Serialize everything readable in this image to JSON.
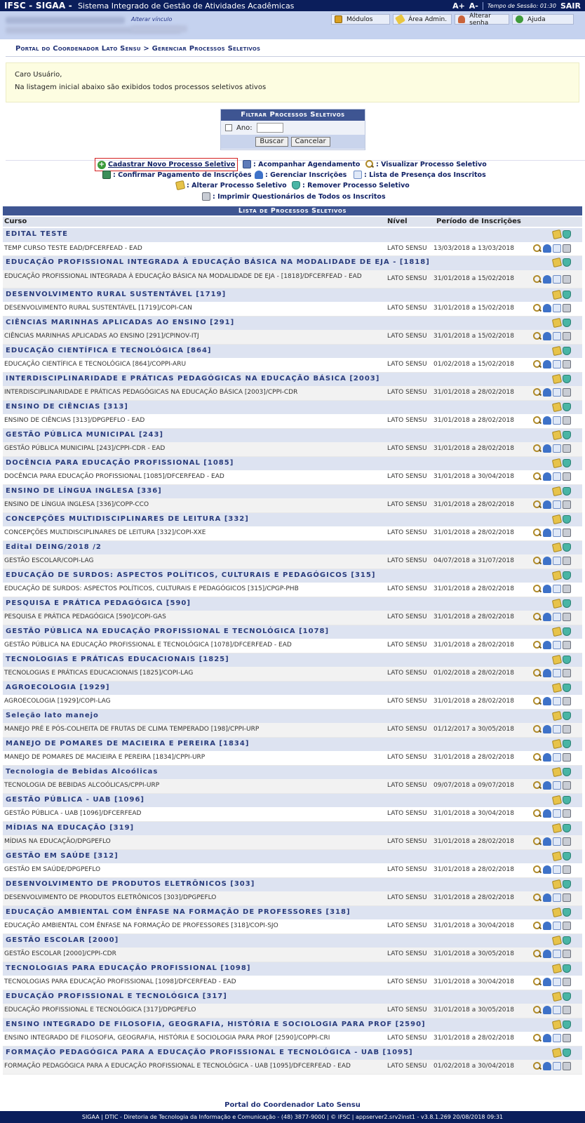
{
  "topbar": {
    "brand": "IFSC - SIGAA -",
    "subtitle": "Sistema Integrado de Gestão de Atividades Acadêmicas",
    "font_inc": "A+",
    "font_dec": "A-",
    "session_label": "Tempo de Sessão: 01:30",
    "logout": "SAIR"
  },
  "userbar": {
    "alter_link": "Alterar vínculo",
    "menu": {
      "modulos": "Módulos",
      "area_admin": "Área Admin.",
      "alterar_senha": "Alterar senha",
      "ajuda": "Ajuda"
    }
  },
  "breadcrumb": "Portal do Coordenador Lato Sensu > Gerenciar Processos Seletivos",
  "info": {
    "greeting": "Caro Usuário,",
    "message": "Na listagem inicial abaixo são exibidos todos processos seletivos ativos"
  },
  "filter": {
    "title": "Filtrar Processos Seletivos",
    "ano_label": "Ano:",
    "buscar": "Buscar",
    "cancelar": "Cancelar"
  },
  "legend": {
    "cadastrar": "Cadastrar Novo Processo Seletivo",
    "acompanhar": ": Acompanhar Agendamento",
    "visualizar": ": Visualizar Processo Seletivo",
    "confirmar": ": Confirmar Pagamento de Inscrições",
    "gerenciar": ": Gerenciar Inscrições",
    "lista_presenca": ": Lista de Presença dos Inscritos",
    "alterar": ": Alterar Processo Seletivo",
    "remover": ": Remover Processo Seletivo",
    "imprimir": ": Imprimir Questionários de Todos os Inscritos"
  },
  "table": {
    "caption": "Lista de Processos Seletivos",
    "col_curso": "Curso",
    "col_nivel": "Nível",
    "col_periodo": "Período de Inscrições",
    "groups": [
      {
        "title": "EDITAL TESTE",
        "curso": "TEMP CURSO TESTE EAD/DFCERFEAD - EAD",
        "nivel": "LATO SENSU",
        "periodo": "13/03/2018 a 13/03/2018"
      },
      {
        "title": "EDUCAÇÃO PROFISSIONAL INTEGRADA À EDUCAÇÃO BÁSICA NA MODALIDADE DE EJA - [1818]",
        "curso": "EDUCAÇÃO PROFISSIONAL INTEGRADA À EDUCAÇÃO BÁSICA NA MODALIDADE DE EJA - [1818]/DFCERFEAD - EAD",
        "nivel": "LATO SENSU",
        "periodo": "31/01/2018 a 15/02/2018"
      },
      {
        "title": "DESENVOLVIMENTO RURAL SUSTENTÁVEL [1719]",
        "curso": "DESENVOLVIMENTO RURAL SUSTENTÁVEL [1719]/COPI-CAN",
        "nivel": "LATO SENSU",
        "periodo": "31/01/2018 a 15/02/2018"
      },
      {
        "title": "CIÊNCIAS MARINHAS APLICADAS AO ENSINO [291]",
        "curso": "CIÊNCIAS MARINHAS APLICADAS AO ENSINO [291]/CPINOV-ITJ",
        "nivel": "LATO SENSU",
        "periodo": "31/01/2018 a 15/02/2018"
      },
      {
        "title": "EDUCAÇÃO CIENTÍFICA E TECNOLÓGICA [864]",
        "curso": "EDUCAÇÃO CIENTÍFICA E TECNOLÓGICA [864]/COPPI-ARU",
        "nivel": "LATO SENSU",
        "periodo": "01/02/2018 a 15/02/2018"
      },
      {
        "title": "INTERDISCIPLINARIDADE E PRÁTICAS PEDAGÓGICAS NA EDUCAÇÃO BÁSICA [2003]",
        "curso": "INTERDISCIPLINARIDADE E PRÁTICAS PEDAGÓGICAS NA EDUCAÇÃO BÁSICA [2003]/CPPI-CDR",
        "nivel": "LATO SENSU",
        "periodo": "31/01/2018 a 28/02/2018"
      },
      {
        "title": "ENSINO DE CIÊNCIAS [313]",
        "curso": "ENSINO DE CIÊNCIAS [313]/DPGPEFLO - EAD",
        "nivel": "LATO SENSU",
        "periodo": "31/01/2018 a 28/02/2018"
      },
      {
        "title": "GESTÃO PÚBLICA MUNICIPAL [243]",
        "curso": "GESTÃO PÚBLICA MUNICIPAL [243]/CPPI-CDR - EAD",
        "nivel": "LATO SENSU",
        "periodo": "31/01/2018 a 28/02/2018"
      },
      {
        "title": "DOCÊNCIA PARA EDUCAÇÃO PROFISSIONAL [1085]",
        "curso": "DOCÊNCIA PARA EDUCAÇÃO PROFISSIONAL [1085]/DFCERFEAD - EAD",
        "nivel": "LATO SENSU",
        "periodo": "31/01/2018 a 30/04/2018"
      },
      {
        "title": "ENSINO DE LÍNGUA INGLESA [336]",
        "curso": "ENSINO DE LÍNGUA INGLESA [336]/COPP-CCO",
        "nivel": "LATO SENSU",
        "periodo": "31/01/2018 a 28/02/2018"
      },
      {
        "title": "CONCEPÇÕES MULTIDISCIPLINARES DE LEITURA [332]",
        "curso": "CONCEPÇÕES MULTIDISCIPLINARES DE LEITURA [332]/COPI-XXE",
        "nivel": "LATO SENSU",
        "periodo": "31/01/2018 a 28/02/2018"
      },
      {
        "title": "Edital DEING/2018 /2",
        "curso": "GESTÃO ESCOLAR/COPI-LAG",
        "nivel": "LATO SENSU",
        "periodo": "04/07/2018 a 31/07/2018"
      },
      {
        "title": "EDUCAÇÃO DE SURDOS: ASPECTOS POLÍTICOS, CULTURAIS E PEDAGÓGICOS [315]",
        "curso": "EDUCAÇÃO DE SURDOS: ASPECTOS POLÍTICOS, CULTURAIS E PEDAGÓGICOS [315]/CPGP-PHB",
        "nivel": "LATO SENSU",
        "periodo": "31/01/2018 a 28/02/2018"
      },
      {
        "title": "PESQUISA E PRÁTICA PEDAGÓGICA [590]",
        "curso": "PESQUISA E PRÁTICA PEDAGÓGICA [590]/COPI-GAS",
        "nivel": "LATO SENSU",
        "periodo": "31/01/2018 a 28/02/2018"
      },
      {
        "title": "GESTÃO PÚBLICA NA EDUCAÇÃO PROFISSIONAL E TECNOLÓGICA [1078]",
        "curso": "GESTÃO PÚBLICA NA EDUCAÇÃO PROFISSIONAL E TECNOLÓGICA [1078]/DFCERFEAD - EAD",
        "nivel": "LATO SENSU",
        "periodo": "31/01/2018 a 28/02/2018"
      },
      {
        "title": "TECNOLOGIAS E PRÁTICAS EDUCACIONAIS [1825]",
        "curso": "TECNOLOGIAS E PRÁTICAS EDUCACIONAIS [1825]/COPI-LAG",
        "nivel": "LATO SENSU",
        "periodo": "01/02/2018 a 28/02/2018"
      },
      {
        "title": "AGROECOLOGIA [1929]",
        "curso": "AGROECOLOGIA [1929]/COPI-LAG",
        "nivel": "LATO SENSU",
        "periodo": "31/01/2018 a 28/02/2018"
      },
      {
        "title": "Seleção lato manejo",
        "curso": "MANEJO PRÉ E PÓS-COLHEITA DE FRUTAS DE CLIMA TEMPERADO [198]/CPPI-URP",
        "nivel": "LATO SENSU",
        "periodo": "01/12/2017 a 30/05/2018"
      },
      {
        "title": "MANEJO DE POMARES DE MACIEIRA E PEREIRA [1834]",
        "curso": "MANEJO DE POMARES DE MACIEIRA E PEREIRA [1834]/CPPI-URP",
        "nivel": "LATO SENSU",
        "periodo": "31/01/2018 a 28/02/2018"
      },
      {
        "title": "Tecnologia de Bebidas Alcoólicas",
        "curso": "TECNOLOGIA DE BEBIDAS ALCOÓLICAS/CPPI-URP",
        "nivel": "LATO SENSU",
        "periodo": "09/07/2018 a 09/07/2018"
      },
      {
        "title": "GESTÃO PÚBLICA - UAB [1096]",
        "curso": "GESTÃO PÚBLICA - UAB [1096]/DFCERFEAD",
        "nivel": "LATO SENSU",
        "periodo": "31/01/2018 a 30/04/2018"
      },
      {
        "title": "MÍDIAS NA EDUCAÇÃO [319]",
        "curso": "MÍDIAS NA EDUCAÇÃO/DPGPEFLO",
        "nivel": "LATO SENSU",
        "periodo": "31/01/2018 a 28/02/2018"
      },
      {
        "title": "GESTÃO EM SAÚDE [312]",
        "curso": "GESTÃO EM SAÚDE/DPGPEFLO",
        "nivel": "LATO SENSU",
        "periodo": "31/01/2018 a 28/02/2018"
      },
      {
        "title": "DESENVOLVIMENTO DE PRODUTOS ELETRÔNICOS [303]",
        "curso": "DESENVOLVIMENTO DE PRODUTOS ELETRÔNICOS [303]/DPGPEFLO",
        "nivel": "LATO SENSU",
        "periodo": "31/01/2018 a 28/02/2018"
      },
      {
        "title": "EDUCAÇÃO AMBIENTAL COM ÊNFASE NA FORMAÇÃO DE PROFESSORES [318]",
        "curso": "EDUCAÇÃO AMBIENTAL COM ÊNFASE NA FORMAÇÃO DE PROFESSORES [318]/COPI-SJO",
        "nivel": "LATO SENSU",
        "periodo": "31/01/2018 a 30/04/2018"
      },
      {
        "title": "GESTÃO ESCOLAR [2000]",
        "curso": "GESTÃO ESCOLAR [2000]/CPPI-CDR",
        "nivel": "LATO SENSU",
        "periodo": "31/01/2018 a 30/05/2018"
      },
      {
        "title": "TECNOLOGIAS PARA EDUCAÇÃO PROFISSIONAL [1098]",
        "curso": "TECNOLOGIAS PARA EDUCAÇÃO PROFISSIONAL [1098]/DFCERFEAD - EAD",
        "nivel": "LATO SENSU",
        "periodo": "31/01/2018 a 30/04/2018"
      },
      {
        "title": "EDUCAÇÃO PROFISSIONAL E TECNOLÓGICA [317]",
        "curso": "EDUCAÇÃO PROFISSIONAL E TECNOLÓGICA [317]/DPGPEFLO",
        "nivel": "LATO SENSU",
        "periodo": "31/01/2018 a 30/05/2018"
      },
      {
        "title": "ENSINO INTEGRADO DE FILOSOFIA, GEOGRAFIA, HISTÓRIA E SOCIOLOGIA PARA PROF [2590]",
        "curso": "ENSINO INTEGRADO DE FILOSOFIA, GEOGRAFIA, HISTÓRIA E SOCIOLOGIA PARA PROF [2590]/COPPI-CRI",
        "nivel": "LATO SENSU",
        "periodo": "31/01/2018 a 28/02/2018"
      },
      {
        "title": "FORMAÇÃO PEDAGÓGICA PARA A EDUCAÇÃO PROFISSIONAL E TECNOLÓGICA - UAB [1095]",
        "curso": "FORMAÇÃO PEDAGÓGICA PARA A EDUCAÇÃO PROFISSIONAL E TECNOLÓGICA - UAB [1095]/DFCERFEAD - EAD",
        "nivel": "LATO SENSU",
        "periodo": "01/02/2018 a 30/04/2018"
      }
    ]
  },
  "footer": {
    "portal_link": "Portal do Coordenador Lato Sensu",
    "text": "SIGAA | DTIC - Diretoria de Tecnologia da Informação e Comunicação - (48) 3877-9000 | © IFSC | appserver2.srv2inst1 - v3.8.1.269 20/08/2018 09:31"
  }
}
